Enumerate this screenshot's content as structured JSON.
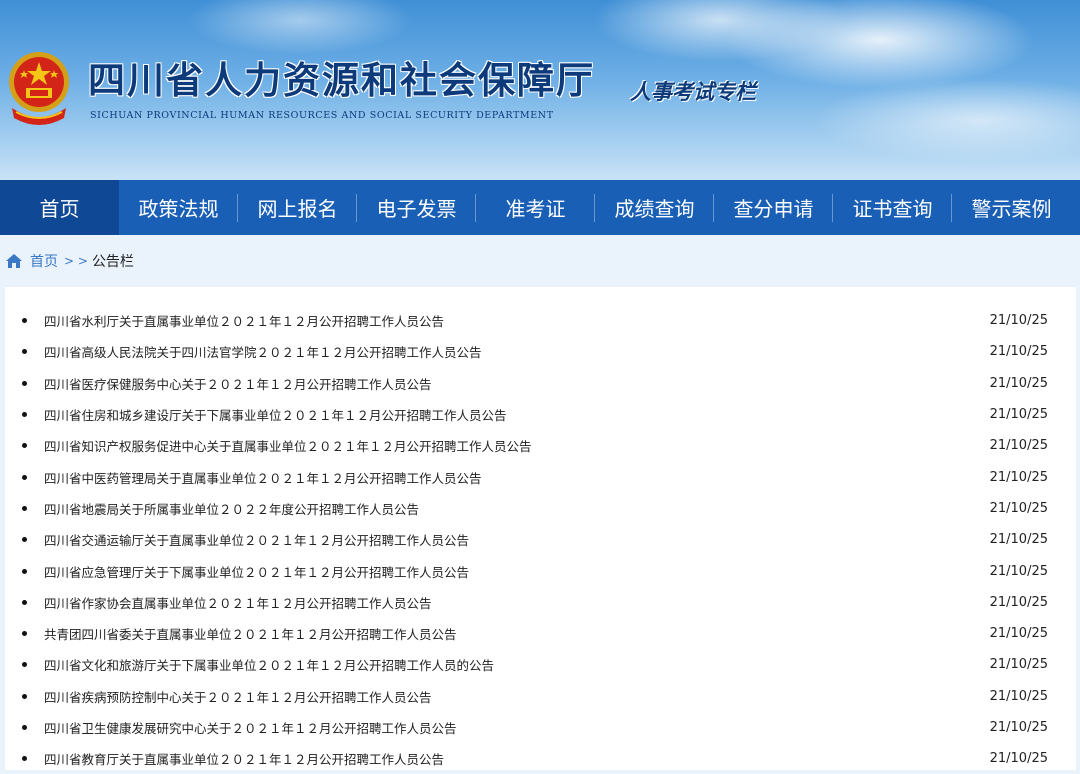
{
  "header": {
    "title": "四川省人力资源和社会保障厅",
    "subtitle": "SICHUAN PROVINCIAL HUMAN RESOURCES AND SOCIAL SECURITY DEPARTMENT",
    "column": "人事考试专栏"
  },
  "nav": {
    "items": [
      {
        "label": "首页",
        "active": true
      },
      {
        "label": "政策法规"
      },
      {
        "label": "网上报名"
      },
      {
        "label": "电子发票"
      },
      {
        "label": "准考证"
      },
      {
        "label": "成绩查询"
      },
      {
        "label": "查分申请"
      },
      {
        "label": "证书查询"
      },
      {
        "label": "警示案例"
      }
    ]
  },
  "breadcrumb": {
    "home": "首页",
    "sep": "> >",
    "current": "公告栏"
  },
  "notices": [
    {
      "title": "四川省水利厅关于直属事业单位２０２１年１２月公开招聘工作人员公告",
      "date": "21/10/25"
    },
    {
      "title": "四川省高级人民法院关于四川法官学院２０２１年１２月公开招聘工作人员公告",
      "date": "21/10/25"
    },
    {
      "title": "四川省医疗保健服务中心关于２０２１年１２月公开招聘工作人员公告",
      "date": "21/10/25"
    },
    {
      "title": "四川省住房和城乡建设厅关于下属事业单位２０２１年１２月公开招聘工作人员公告",
      "date": "21/10/25"
    },
    {
      "title": "四川省知识产权服务促进中心关于直属事业单位２０２１年１２月公开招聘工作人员公告",
      "date": "21/10/25"
    },
    {
      "title": "四川省中医药管理局关于直属事业单位２０２１年１２月公开招聘工作人员公告",
      "date": "21/10/25"
    },
    {
      "title": "四川省地震局关于所属事业单位２０２２年度公开招聘工作人员公告",
      "date": "21/10/25"
    },
    {
      "title": "四川省交通运输厅关于直属事业单位２０２１年１２月公开招聘工作人员公告",
      "date": "21/10/25"
    },
    {
      "title": "四川省应急管理厅关于下属事业单位２０２１年１２月公开招聘工作人员公告",
      "date": "21/10/25"
    },
    {
      "title": "四川省作家协会直属事业单位２０２１年１２月公开招聘工作人员公告",
      "date": "21/10/25"
    },
    {
      "title": "共青团四川省委关于直属事业单位２０２１年１２月公开招聘工作人员公告",
      "date": "21/10/25"
    },
    {
      "title": "四川省文化和旅游厅关于下属事业单位２０２１年１２月公开招聘工作人员的公告",
      "date": "21/10/25"
    },
    {
      "title": "四川省疾病预防控制中心关于２０２１年１２月公开招聘工作人员公告",
      "date": "21/10/25"
    },
    {
      "title": "四川省卫生健康发展研究中心关于２０２１年１２月公开招聘工作人员公告",
      "date": "21/10/25"
    },
    {
      "title": "四川省教育厅关于直属事业单位２０２１年１２月公开招聘工作人员公告",
      "date": "21/10/25"
    }
  ]
}
